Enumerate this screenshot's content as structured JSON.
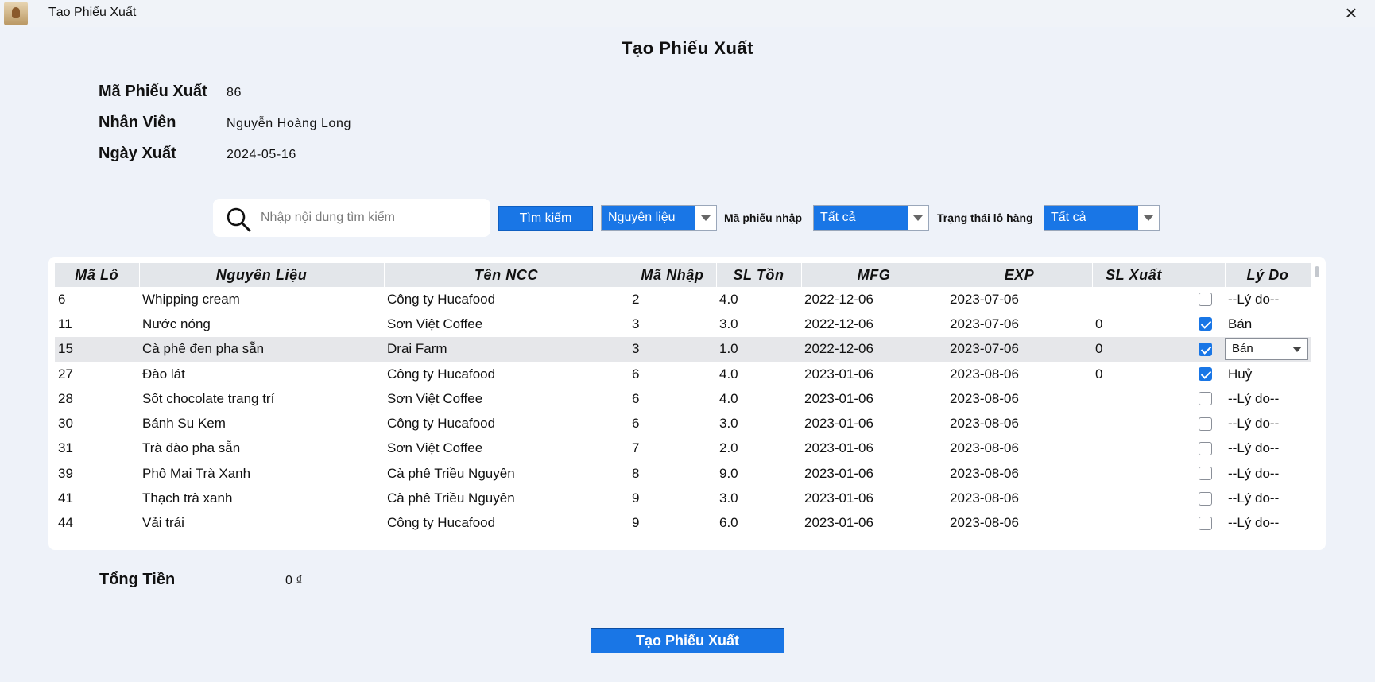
{
  "window": {
    "title": "Tạo Phiếu Xuất"
  },
  "page": {
    "title": "Tạo Phiếu Xuất"
  },
  "info": {
    "ma_phieu_label": "Mã Phiếu Xuất",
    "ma_phieu_value": "86",
    "nhan_vien_label": "Nhân Viên",
    "nhan_vien_value": "Nguyễn Hoàng Long",
    "ngay_label": "Ngày Xuất",
    "ngay_value": "2024-05-16"
  },
  "search": {
    "placeholder": "Nhập nội dung tìm kiếm",
    "button_label": "Tìm kiếm"
  },
  "filters": {
    "category_value": "Nguyên liệu",
    "ma_phieu_nhap_label": "Mã phiếu nhập",
    "ma_phieu_nhap_value": "Tất cả",
    "trang_thai_label": "Trạng thái lô hàng",
    "trang_thai_value": "Tất cả"
  },
  "table": {
    "headers": [
      "Mã Lô",
      "Nguyên Liệu",
      "Tên NCC",
      "Mã Nhập",
      "SL Tồn",
      "MFG",
      "EXP",
      "SL Xuất",
      "",
      "Lý Do"
    ],
    "rows": [
      {
        "ma_lo": "6",
        "nguyen_lieu": "Whipping cream",
        "ncc": "Công ty Hucafood",
        "ma_nhap": "2",
        "sl_ton": "4.0",
        "mfg": "2022-12-06",
        "exp": "2023-07-06",
        "sl_xuat": "",
        "checked": false,
        "ly_do": "--Lý do--"
      },
      {
        "ma_lo": "11",
        "nguyen_lieu": "Nước nóng",
        "ncc": "Sơn Việt Coffee",
        "ma_nhap": "3",
        "sl_ton": "3.0",
        "mfg": "2022-12-06",
        "exp": "2023-07-06",
        "sl_xuat": "0",
        "checked": true,
        "ly_do": "Bán"
      },
      {
        "ma_lo": "15",
        "nguyen_lieu": "Cà phê đen pha sẵn",
        "ncc": "Drai Farm",
        "ma_nhap": "3",
        "sl_ton": "1.0",
        "mfg": "2022-12-06",
        "exp": "2023-07-06",
        "sl_xuat": "0",
        "checked": true,
        "ly_do": "Bán"
      },
      {
        "ma_lo": "27",
        "nguyen_lieu": "Đào lát",
        "ncc": "Công ty Hucafood",
        "ma_nhap": "6",
        "sl_ton": "4.0",
        "mfg": "2023-01-06",
        "exp": "2023-08-06",
        "sl_xuat": "0",
        "checked": true,
        "ly_do": "Huỷ"
      },
      {
        "ma_lo": "28",
        "nguyen_lieu": "Sốt chocolate trang trí",
        "ncc": "Sơn Việt Coffee",
        "ma_nhap": "6",
        "sl_ton": "4.0",
        "mfg": "2023-01-06",
        "exp": "2023-08-06",
        "sl_xuat": "",
        "checked": false,
        "ly_do": "--Lý do--"
      },
      {
        "ma_lo": "30",
        "nguyen_lieu": "Bánh Su Kem",
        "ncc": "Công ty Hucafood",
        "ma_nhap": "6",
        "sl_ton": "3.0",
        "mfg": "2023-01-06",
        "exp": "2023-08-06",
        "sl_xuat": "",
        "checked": false,
        "ly_do": "--Lý do--"
      },
      {
        "ma_lo": "31",
        "nguyen_lieu": "Trà đào pha sẵn",
        "ncc": "Sơn Việt Coffee",
        "ma_nhap": "7",
        "sl_ton": "2.0",
        "mfg": "2023-01-06",
        "exp": "2023-08-06",
        "sl_xuat": "",
        "checked": false,
        "ly_do": "--Lý do--"
      },
      {
        "ma_lo": "39",
        "nguyen_lieu": "Phô Mai Trà Xanh",
        "ncc": "Cà phê Triều Nguyên",
        "ma_nhap": "8",
        "sl_ton": "9.0",
        "mfg": "2023-01-06",
        "exp": "2023-08-06",
        "sl_xuat": "",
        "checked": false,
        "ly_do": "--Lý do--"
      },
      {
        "ma_lo": "41",
        "nguyen_lieu": "Thạch trà xanh",
        "ncc": "Cà phê Triều Nguyên",
        "ma_nhap": "9",
        "sl_ton": "3.0",
        "mfg": "2023-01-06",
        "exp": "2023-08-06",
        "sl_xuat": "",
        "checked": false,
        "ly_do": "--Lý do--"
      },
      {
        "ma_lo": "44",
        "nguyen_lieu": "Vải trái",
        "ncc": "Công ty Hucafood",
        "ma_nhap": "9",
        "sl_ton": "6.0",
        "mfg": "2023-01-06",
        "exp": "2023-08-06",
        "sl_xuat": "",
        "checked": false,
        "ly_do": "--Lý do--"
      }
    ],
    "selected_row": 2
  },
  "total": {
    "label": "Tổng Tiền",
    "value": "0 ₫"
  },
  "actions": {
    "create_label": "Tạo Phiếu Xuất"
  },
  "colors": {
    "accent": "#1976e6",
    "background": "#eef2f9",
    "header_bg": "#e3e6ea"
  }
}
